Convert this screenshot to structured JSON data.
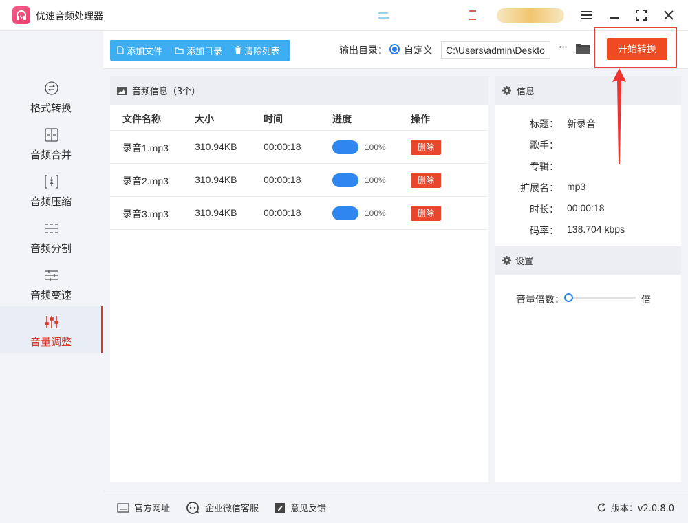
{
  "app": {
    "title": "优速音频处理器"
  },
  "sidebar": {
    "items": [
      {
        "label": "格式转换",
        "icon": "format-convert-icon"
      },
      {
        "label": "音频合并",
        "icon": "merge-icon"
      },
      {
        "label": "音频压缩",
        "icon": "compress-icon"
      },
      {
        "label": "音频分割",
        "icon": "split-icon"
      },
      {
        "label": "音频变速",
        "icon": "speed-icon"
      },
      {
        "label": "音量调整",
        "icon": "volume-sliders-icon",
        "active": true
      }
    ]
  },
  "toolbar": {
    "add_file": "添加文件",
    "add_dir": "添加目录",
    "clear_list": "清除列表",
    "output_label": "输出目录：",
    "custom_label": "自定义",
    "output_path": "C:\\Users\\admin\\Deskto",
    "more": "···",
    "start": "开始转换"
  },
  "file_panel": {
    "title": "音频信息（3个）",
    "columns": [
      "文件名称",
      "大小",
      "时间",
      "进度",
      "操作"
    ],
    "rows": [
      {
        "name": "录音1.mp3",
        "size": "310.94KB",
        "time": "00:00:18",
        "progress": "100%",
        "action": "删除"
      },
      {
        "name": "录音2.mp3",
        "size": "310.94KB",
        "time": "00:00:18",
        "progress": "100%",
        "action": "删除"
      },
      {
        "name": "录音3.mp3",
        "size": "310.94KB",
        "time": "00:00:18",
        "progress": "100%",
        "action": "删除"
      }
    ]
  },
  "info": {
    "title": "信息",
    "fields": [
      {
        "key": "标题：",
        "value": "新录音"
      },
      {
        "key": "歌手：",
        "value": ""
      },
      {
        "key": "专辑：",
        "value": ""
      },
      {
        "key": "扩展名：",
        "value": "mp3"
      },
      {
        "key": "时长：",
        "value": "00:00:18"
      },
      {
        "key": "码率：",
        "value": "138.704 kbps"
      }
    ]
  },
  "settings": {
    "title": "设置",
    "volume_label": "音量倍数：",
    "volume_unit": "倍",
    "volume_value": 0
  },
  "footer": {
    "website": "官方网址",
    "wechat": "企业微信客服",
    "feedback": "意见反馈",
    "version": "版本：v2.0.8.0"
  },
  "colors": {
    "accent_blue": "#3eaef3",
    "start_red": "#f04a23",
    "active_red": "#d33a2c",
    "progress_blue": "#2e86ee"
  }
}
